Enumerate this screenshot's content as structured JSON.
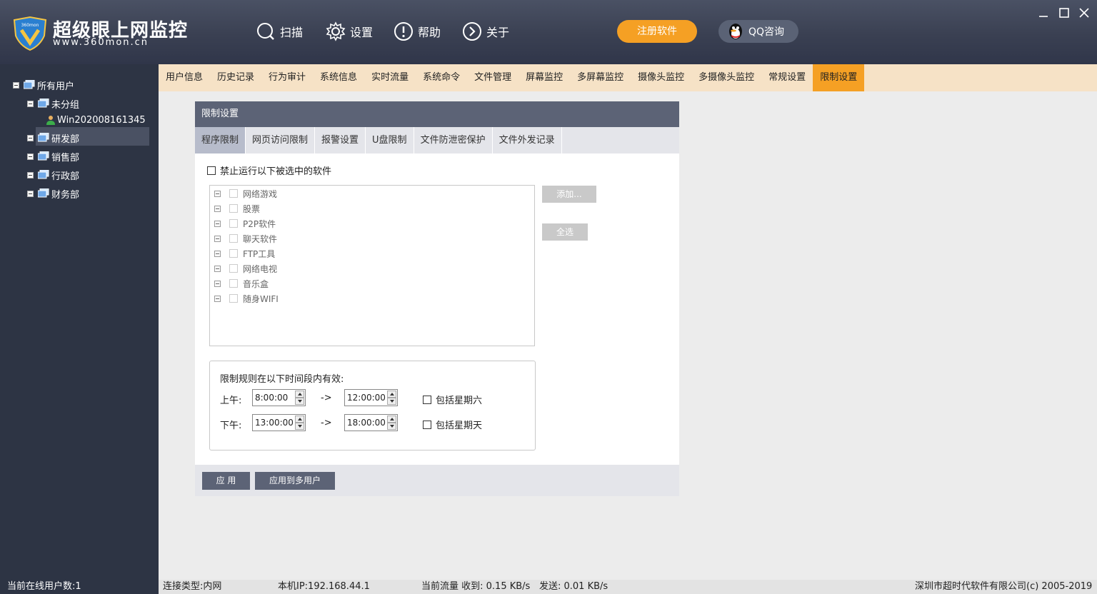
{
  "app": {
    "title": "超级眼上网监控",
    "url": "www.360mon.cn",
    "shield_text": "360mon"
  },
  "topnav": {
    "scan": "扫描",
    "settings": "设置",
    "help": "帮助",
    "about": "关于",
    "register": "注册软件",
    "qq": "QQ咨询"
  },
  "colors": {
    "accent": "#f5a024",
    "titlebar": "#3a4052",
    "sidebar": "#2d3444",
    "panel_header": "#5c6376",
    "tabbar": "#f6e2c6"
  },
  "tree": {
    "root": "所有用户",
    "ungrouped": "未分组",
    "host": "Win202008161345",
    "rd": "研发部",
    "sales": "销售部",
    "admin": "行政部",
    "finance": "财务部"
  },
  "main_tabs": [
    "用户信息",
    "历史记录",
    "行为审计",
    "系统信息",
    "实时流量",
    "系统命令",
    "文件管理",
    "屏幕监控",
    "多屏幕监控",
    "摄像头监控",
    "多摄像头监控",
    "常规设置",
    "限制设置"
  ],
  "main_tab_active": "限制设置",
  "panel": {
    "title": "限制设置",
    "subtabs": [
      "程序限制",
      "网页访问限制",
      "报警设置",
      "U盘限制",
      "文件防泄密保护",
      "文件外发记录"
    ],
    "subtab_active": "程序限制",
    "block_label": "禁止运行以下被选中的软件",
    "categories": [
      "网络游戏",
      "股票",
      "P2P软件",
      "聊天软件",
      "FTP工具",
      "网络电视",
      "音乐盒",
      "随身WIFI"
    ],
    "add_button": "添加...",
    "select_all_button": "全选",
    "time_rule_label": "限制规则在以下时间段内有效:",
    "am_label": "上午:",
    "pm_label": "下午:",
    "arrow": "->",
    "am_start": "8:00:00",
    "am_end": "12:00:00",
    "pm_start": "13:00:00",
    "pm_end": "18:00:00",
    "include_saturday": "包括星期六",
    "include_sunday": "包括星期天",
    "apply_button": "应 用",
    "apply_multi_button": "应用到多用户"
  },
  "status": {
    "online_users": "当前在线用户数:1",
    "connection": "连接类型:内网",
    "local_ip": "本机IP:192.168.44.1",
    "traffic": "当前流量 收到: 0.15 KB/s",
    "sent": "发送: 0.01 KB/s",
    "copyright": "深圳市超时代软件有限公司(c) 2005-2019"
  }
}
